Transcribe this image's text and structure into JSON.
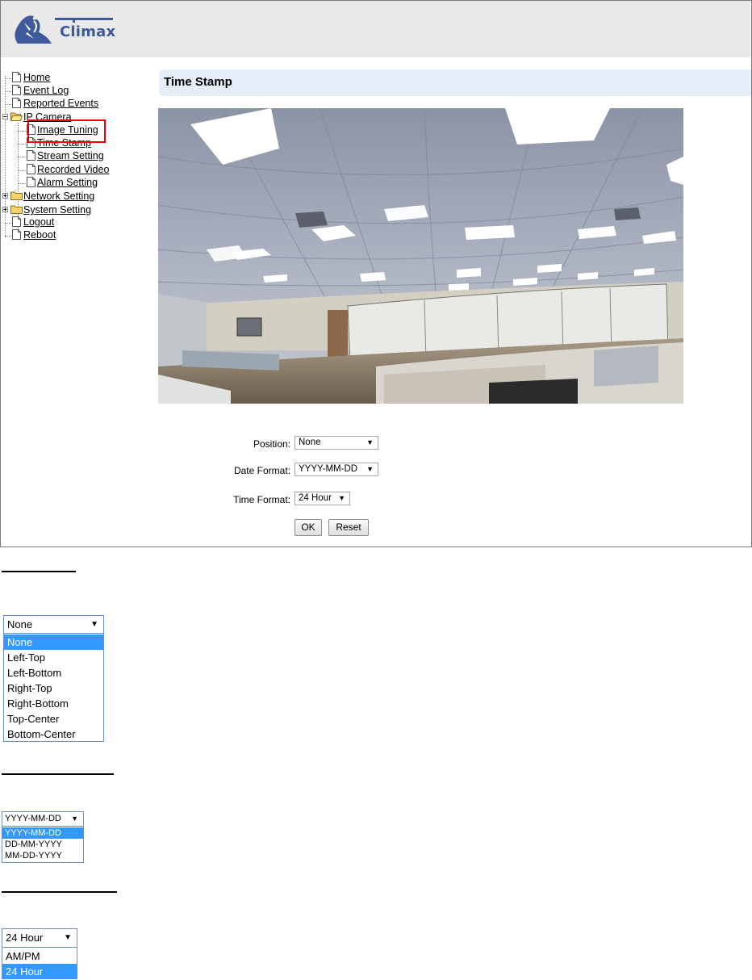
{
  "header": {
    "logo_text": "Climax"
  },
  "nav": {
    "home": "Home",
    "event_log": "Event Log",
    "reported_events": "Reported Events",
    "ip_camera": "IP Camera",
    "image_tuning": "Image Tuning",
    "time_stamp": "Time Stamp",
    "stream_setting": "Stream Setting",
    "recorded_video": "Recorded Video",
    "alarm_setting": "Alarm Setting",
    "network_setting": "Network Setting",
    "system_setting": "System Setting",
    "logout": "Logout",
    "reboot": "Reboot"
  },
  "page": {
    "title": "Time Stamp"
  },
  "form": {
    "position_label": "Position:",
    "position_value": "None",
    "date_label": "Date Format:",
    "date_value": "YYYY-MM-DD",
    "time_label": "Time Format:",
    "time_value": "24 Hour",
    "ok": "OK",
    "reset": "Reset"
  },
  "position_dropdown": {
    "selected": "None",
    "options": [
      "None",
      "Left-Top",
      "Left-Bottom",
      "Right-Top",
      "Right-Bottom",
      "Top-Center",
      "Bottom-Center"
    ]
  },
  "date_dropdown": {
    "selected": "YYYY-MM-DD",
    "options": [
      "YYYY-MM-DD",
      "DD-MM-YYYY",
      "MM-DD-YYYY"
    ]
  },
  "time_dropdown": {
    "selected": "24 Hour",
    "options": [
      "AM/PM",
      "24 Hour"
    ]
  },
  "icons": {
    "arrow": "▼",
    "page": "document-icon",
    "folder": "folder-icon"
  },
  "colors": {
    "title_bar": "#e6eef9",
    "highlight_box": "#ee0000",
    "option_selected": "#3399ff",
    "logo": "#3f5a9a"
  }
}
